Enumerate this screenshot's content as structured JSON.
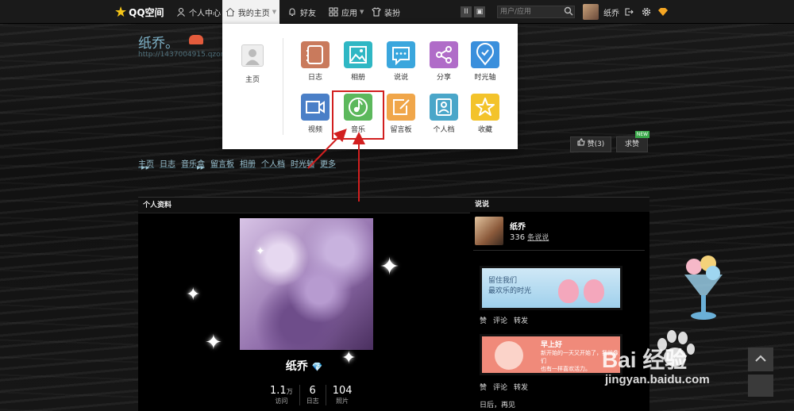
{
  "topbar": {
    "logo": "QQ空间",
    "personal_center": "个人中心",
    "my_home": "我的主页",
    "friends": "好友",
    "apps": "应用",
    "dress": "装扮",
    "pause_icons": [
      "II",
      "▣"
    ],
    "search_placeholder": "用户/应用",
    "username": "纸乔"
  },
  "header": {
    "title": "纸乔。",
    "url": "http://1437004915.qzone."
  },
  "nav_links": [
    "主页",
    "日志",
    "音乐盒",
    "留言板",
    "相册",
    "个人档",
    "时光轴",
    "更多"
  ],
  "nav_arrows": "▶▶",
  "like_button": "赞(3)",
  "ask_like_button": "求赞",
  "new_tag": "NEW",
  "dropdown": {
    "home_label": "主页",
    "apps": [
      {
        "label": "日志",
        "color": "#c97a5c"
      },
      {
        "label": "相册",
        "color": "#2fb7c4"
      },
      {
        "label": "说说",
        "color": "#3aa6dd"
      },
      {
        "label": "分享",
        "color": "#b06cc8"
      },
      {
        "label": "时光轴",
        "color": "#3a8fdc"
      },
      {
        "label": "视频",
        "color": "#4a7fc7"
      },
      {
        "label": "音乐",
        "color": "#5cb85c"
      },
      {
        "label": "留言板",
        "color": "#f0a64a"
      },
      {
        "label": "个人档",
        "color": "#4aa6c9"
      },
      {
        "label": "收藏",
        "color": "#f3c32b"
      }
    ]
  },
  "profile": {
    "section_title": "个人资料",
    "name": "纸乔",
    "name_badge": "💎",
    "stats": [
      {
        "value": "1.1",
        "unit": "万",
        "label": "访问"
      },
      {
        "value": "6",
        "unit": "",
        "label": "日志"
      },
      {
        "value": "104",
        "unit": "",
        "label": "照片"
      }
    ]
  },
  "shuoshuo": {
    "section_title": "说说",
    "name": "纸乔",
    "count": "336",
    "count_label": "条说说",
    "sticker1_text": [
      "留住我们",
      "最欢乐的时光"
    ],
    "sticker2_text": [
      "早上好",
      "新开始的一天又开始了，我就像们",
      "也有一样喜欢活力。"
    ],
    "actions": [
      "赞",
      "评论",
      "转发"
    ],
    "last_line": "日后，再见"
  },
  "watermark": {
    "brand": "Bai 经验",
    "url": "jingyan.baidu.com"
  }
}
